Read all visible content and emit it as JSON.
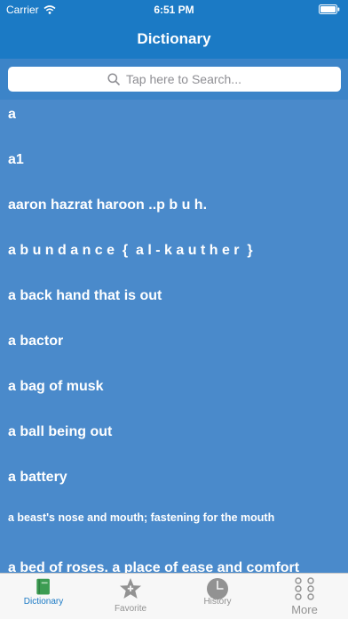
{
  "status_bar": {
    "carrier": "Carrier",
    "time": "6:51 PM"
  },
  "nav": {
    "title": "Dictionary"
  },
  "search": {
    "placeholder": "Tap here to Search..."
  },
  "words": [
    "a",
    "a1",
    "aaron hazrat haroon ..p b u h.",
    "a b u n d a n c e  {  a l - k a u t h e r  }",
    "a back hand that is out",
    "a bactor",
    "a bag of musk",
    "a ball being out",
    "a battery",
    "a beast's nose and mouth; fastening for the mouth",
    "a bed of roses. a place of ease and comfort"
  ],
  "tabs": [
    {
      "label": "Dictionary",
      "icon": "book-icon",
      "active": true
    },
    {
      "label": "Favorite",
      "icon": "star-icon",
      "active": false
    },
    {
      "label": "History",
      "icon": "clock-icon",
      "active": false
    },
    {
      "label": "More",
      "icon": "more-dots-icon",
      "active": false
    }
  ],
  "colors": {
    "header_blue": "#1b7ac5",
    "list_background": "#4a8acb",
    "search_area": "#3c84c8",
    "tab_active": "#1b7ac5",
    "book_icon_green": "#3c9c52",
    "tab_inactive": "#929292"
  }
}
